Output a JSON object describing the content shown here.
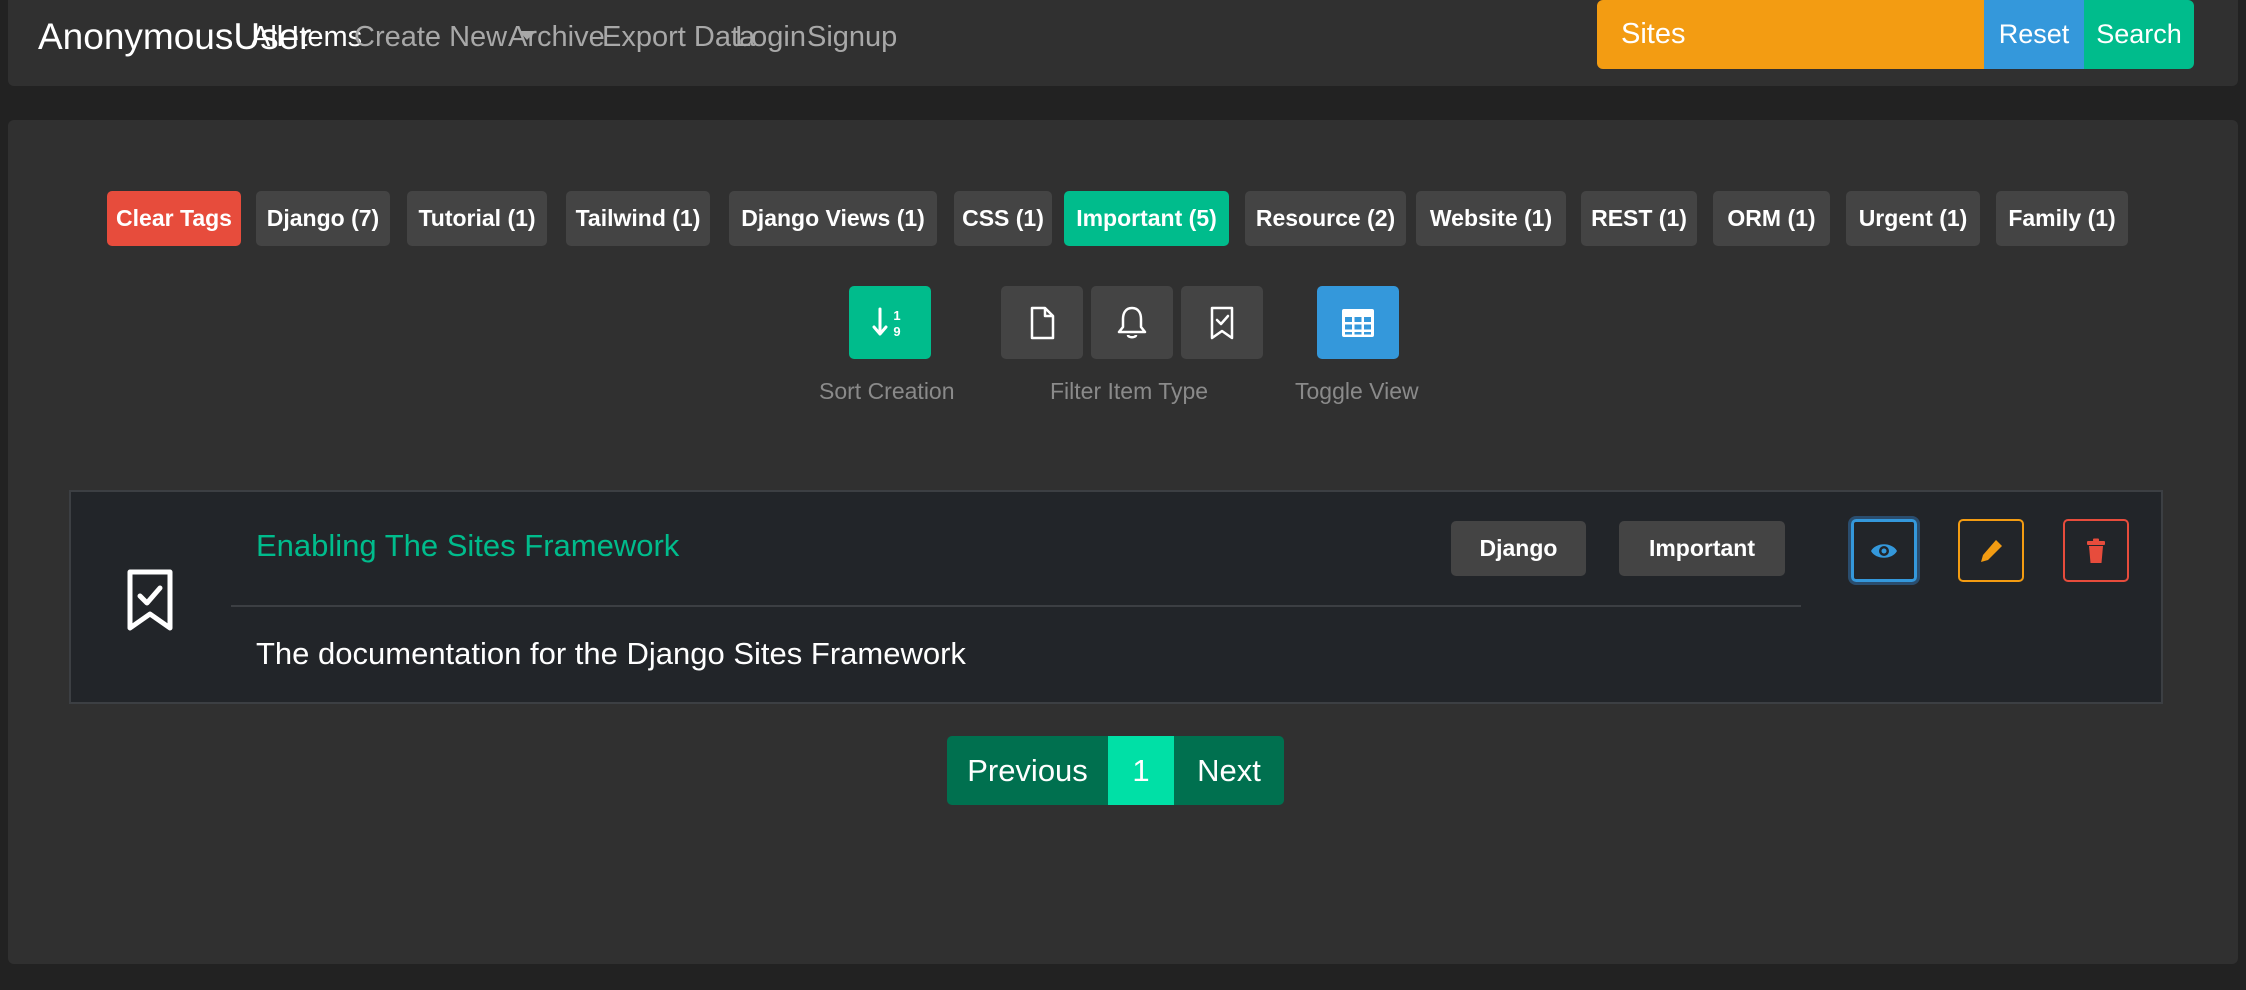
{
  "navbar": {
    "brand": "AnonymousUser",
    "links": {
      "all_items": "All Items",
      "create_new": "Create New",
      "archive": "Archive",
      "export_data": "Export Data",
      "login": "Login",
      "signup": "Signup"
    },
    "search": {
      "value": "Sites",
      "reset_label": "Reset",
      "search_label": "Search"
    }
  },
  "tags": {
    "clear": "Clear Tags",
    "items": [
      "Django (7)",
      "Tutorial (1)",
      "Tailwind (1)",
      "Django Views (1)",
      "CSS (1)",
      "Important (5)",
      "Resource (2)",
      "Website (1)",
      "REST (1)",
      "ORM (1)",
      "Urgent (1)",
      "Family (1)"
    ],
    "active": "Important (5)"
  },
  "controls": {
    "sort_label": "Sort Creation",
    "filter_label": "Filter Item Type",
    "toggle_label": "Toggle View",
    "sort_icon_top": "1",
    "sort_icon_bottom": "9"
  },
  "item": {
    "title": "Enabling The Sites Framework",
    "description": "The documentation for the Django Sites Framework",
    "tags": [
      "Django",
      "Important"
    ],
    "type_icon": "bookmark-check-icon"
  },
  "pagination": {
    "previous": "Previous",
    "current": "1",
    "next": "Next"
  },
  "colors": {
    "accent_green": "#00bc8c",
    "accent_blue": "#3498db",
    "accent_orange": "#f39c12",
    "accent_red": "#e74c3c",
    "background": "#222222",
    "panel": "#303030"
  }
}
